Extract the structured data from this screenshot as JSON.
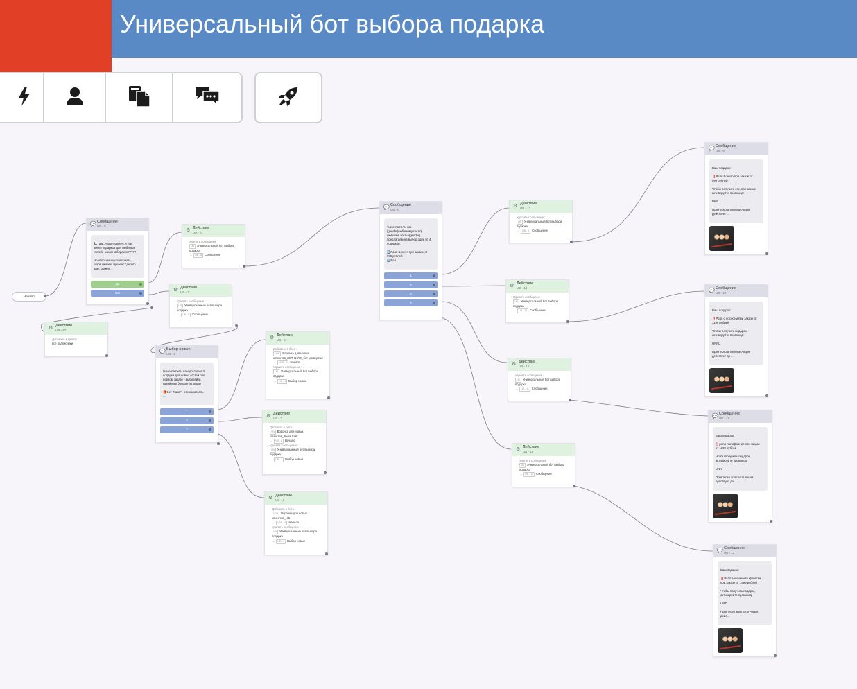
{
  "header": {
    "title": "Универсальный бот выбора подарка"
  },
  "colors": {
    "header_bg": "#5a8ac6",
    "logo_bg": "#e23f27",
    "message_head": "#dcdde6",
    "action_head": "#dff2df",
    "button_green": "#9fcf8d",
    "button_blue": "#8aa4d8"
  },
  "toolbar": {
    "buttons": [
      {
        "icon": "lightning-icon"
      },
      {
        "icon": "user-icon"
      },
      {
        "icon": "documents-icon"
      },
      {
        "icon": "chat-bubbles-icon"
      }
    ],
    "launch": {
      "icon": "rocket-icon"
    }
  },
  "start": {
    "label": "Начало"
  },
  "nodes": {
    "m5": {
      "title": "Сообщение",
      "id": "UB - 5",
      "lines": [
        "📞Таак, %username%, у нас",
        "много подарков для любимых",
        "гостей - какой забираете?????",
        "",
        "Но чтобы мы могли понять,",
        "какой именно презент сделать",
        "вам, скажит..."
      ],
      "buttons": [
        "Да",
        "Нет"
      ]
    },
    "a6": {
      "title": "Действие",
      "id": "UB - 6",
      "del_label": "Удалить сообщение :",
      "del_tag": "UB",
      "del_value": "Универсальный бот выбора подарка",
      "goto_tag": "UB - 8",
      "goto_value": "Сообщение"
    },
    "a7": {
      "title": "Действие",
      "id": "UB - 7",
      "del_label": "Удалить сообщение :",
      "del_tag": "UB",
      "del_value": "Универсальный бот выбора подарка",
      "goto_tag": "UB - 8",
      "goto_value": "Сообщение"
    },
    "a17": {
      "title": "Действие",
      "id": "UB - 17",
      "add_label": "Добавить в группу :",
      "add_value": "все подписчики"
    },
    "m1": {
      "title": "Выбор новые",
      "id": "UB - 1",
      "lines": [
        "%username%, вам доступно 3",
        "подарка для новых гостей при",
        "первом заказе - выбирайте,",
        "какой вам больше по душе!",
        "",
        "🎁Сет \"Капа\" - это колоссаль",
        "..."
      ],
      "buttons": [
        "1",
        "2",
        "3"
      ]
    },
    "a2": {
      "title": "Действие",
      "id": "UB - 2",
      "add_label": "Добавить в бота :",
      "add_tag": "UNB",
      "add_value": "Воронка для новых клиентов_СЕТ КИЛО_бот универсал",
      "add_goto_tag": "VNB - 6",
      "add_goto": "Начало",
      "del_label": "Удалить сообщение :",
      "del_tag": "UB",
      "del_value": "Универсальный бот выбора подарка",
      "goto_tag": "UB - 1",
      "goto_value": "Выбор новые"
    },
    "a3": {
      "title": "Действие",
      "id": "UB - 3",
      "add_label": "Добавить в бота :",
      "add_tag": "VB",
      "add_value": "Воронка для новых клиентов_Фила Лайт",
      "add_goto_tag": "VB - 6",
      "add_goto": "Начало",
      "del_label": "Удалить сообщение :",
      "del_tag": "UB",
      "del_value": "Универсальный бот выбора подарка",
      "goto_tag": "UB - 1",
      "goto_value": "Выбор новые"
    },
    "a4": {
      "title": "Действие",
      "id": "UB - 4",
      "add_label": "Добавить в бота :",
      "add_tag": "VDB",
      "add_value": "Воронка для новых клиентов_-35",
      "add_goto_tag": "VDB - 6",
      "add_goto": "Начало",
      "del_label": "Удалить сообщение :",
      "del_tag": "UB",
      "del_value": "Универсальный бот выбора подарка",
      "goto_tag": "UB - 1",
      "goto_value": "Выбор новые"
    },
    "m8": {
      "title": "Сообщение",
      "id": "UB - 8",
      "lines": [
        "%username%, как",
        "{gender|любимому гостю|",
        "любимой гостье|gender}",
        "предлагаем на выбор один из 4",
        "подарков:",
        "",
        "1️⃣Ролл Бонито при заказе от",
        "999 рублей",
        "2️⃣Рол..."
      ],
      "buttons": [
        "1",
        "2",
        "3",
        "4"
      ]
    },
    "a13": {
      "title": "Действие",
      "id": "UB - 13",
      "del_label": "Удалить сообщение :",
      "del_tag": "UB",
      "del_value": "Универсальный бот выбора подарка",
      "goto_tag": "UB - 9",
      "goto_value": "Сообщение"
    },
    "a14": {
      "title": "Действие",
      "id": "UB - 14",
      "del_label": "Удалить сообщение :",
      "del_tag": "UB",
      "del_value": "Универсальный бот выбора подарка",
      "goto_tag": "UB - 10",
      "goto_value": "Сообщение"
    },
    "a15": {
      "title": "Действие",
      "id": "UB - 15",
      "del_label": "Удалить сообщение :",
      "del_tag": "UB",
      "del_value": "Универсальный бот выбора подарка",
      "goto_tag": "UB - 11",
      "goto_value": "Сообщение"
    },
    "a16": {
      "title": "Действие",
      "id": "UB - 16",
      "del_label": "Удалить сообщение :",
      "del_tag": "UB",
      "del_value": "Универсальный бот выбора подарка",
      "goto_tag": "UB - 12",
      "goto_value": "Сообщение"
    },
    "m9": {
      "title": "Сообщение",
      "id": "UB - 9",
      "lines": [
        "Ваш подарок:",
        "",
        "‼️Ролл Бонито при заказе от",
        "999 рублей",
        "",
        "Чтобы получить его, при заказе",
        "активируйте промокод:",
        "",
        "UNB",
        "",
        "Приятного аппетита! Акция",
        "действует ..."
      ]
    },
    "m10": {
      "title": "Сообщение",
      "id": "UB - 10",
      "lines": [
        "Ваш подарок:",
        "",
        "‼️Ролл с лососем при заказе от",
        "1199 рублей",
        "",
        "Чтобы получить подарок,",
        "активируйте промокод:",
        "",
        "UNRL",
        "",
        "Приятного аппетита! Акция",
        "действует до ..."
      ]
    },
    "m11": {
      "title": "Сообщение",
      "id": "UB - 11",
      "lines": [
        "Ваш подарок:",
        "",
        "‼️ролл Калифорния при заказе",
        "от 1299 рублей",
        "",
        "Чтобы получить подарок,",
        "активируйте промокод:",
        "",
        "UNK",
        "",
        "Приятного аппетита! Акция",
        "действует до ..."
      ]
    },
    "m12": {
      "title": "Сообщение",
      "id": "UB - 12",
      "lines": [
        "Ваш подарок:",
        "",
        "‼️Ролл запеченная креветка",
        "при заказе от 1599 рублей",
        "",
        "Чтобы получить подарок,",
        "активируйте промокод:",
        "",
        "UNZ",
        "",
        "Приятного аппетита! Акция",
        "дейс..."
      ]
    }
  }
}
